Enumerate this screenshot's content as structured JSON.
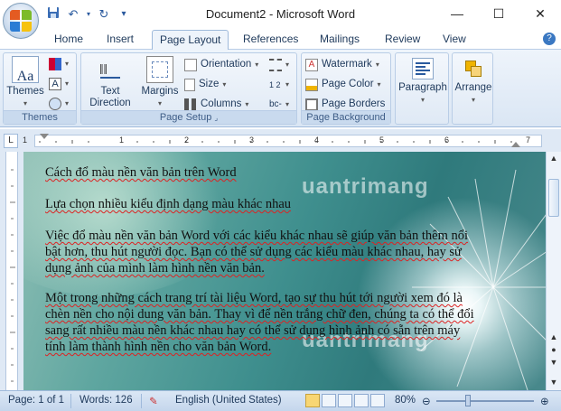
{
  "window": {
    "title": "Document2 - Microsoft Word"
  },
  "tabs": [
    "Home",
    "Insert",
    "Page Layout",
    "References",
    "Mailings",
    "Review",
    "View"
  ],
  "active_tab": "Page Layout",
  "ribbon": {
    "themes": {
      "button": "Themes",
      "group_label": "Themes"
    },
    "page_setup": {
      "text_direction": "Text\nDirection",
      "margins": "Margins",
      "orientation": "Orientation",
      "size": "Size",
      "columns": "Columns",
      "group_label": "Page Setup"
    },
    "page_background": {
      "watermark": "Watermark",
      "page_color": "Page Color",
      "page_borders": "Page Borders",
      "group_label": "Page Background"
    },
    "paragraph": "Paragraph",
    "arrange": "Arrange"
  },
  "ruler": {
    "marks": [
      "1",
      "1",
      "2",
      "3",
      "4",
      "5",
      "6",
      "7"
    ],
    "tab_selector": "L"
  },
  "document": {
    "line1": "Cách đổ màu nền văn bản trên Word",
    "line2": "Lựa chọn nhiều kiểu định dạng màu khác nhau",
    "para1": [
      "Việc đổ màu nền văn bản Word với các kiểu khác nhau sẽ giúp văn bản thêm nổi",
      "bật hơn, thu hút người đọc. Bạn có thể sử dụng các kiểu màu khác nhau, hay sử",
      "dụng ảnh của mình làm hình nền văn bản."
    ],
    "para2": [
      "Một trong những cách trang trí tài liệu Word, tạo sự thu hút tới người xem đó là",
      "chèn nền cho nội dung văn bản. Thay vì để nền trắng chữ đen, chúng ta có thể đổi",
      "sang rất nhiều màu nền khác nhau hay có thể sử dụng hình ảnh có sẵn trên máy",
      "tính làm thành hình nền cho văn bản Word."
    ],
    "watermark_text": "uantrimang"
  },
  "status": {
    "page": "Page: 1 of 1",
    "words": "Words: 126",
    "language": "English (United States)",
    "zoom": "80%",
    "zoom_level": 0.8
  },
  "colors": {
    "accent": "#2b579a",
    "ribbon_bg": "#dae6f4"
  }
}
